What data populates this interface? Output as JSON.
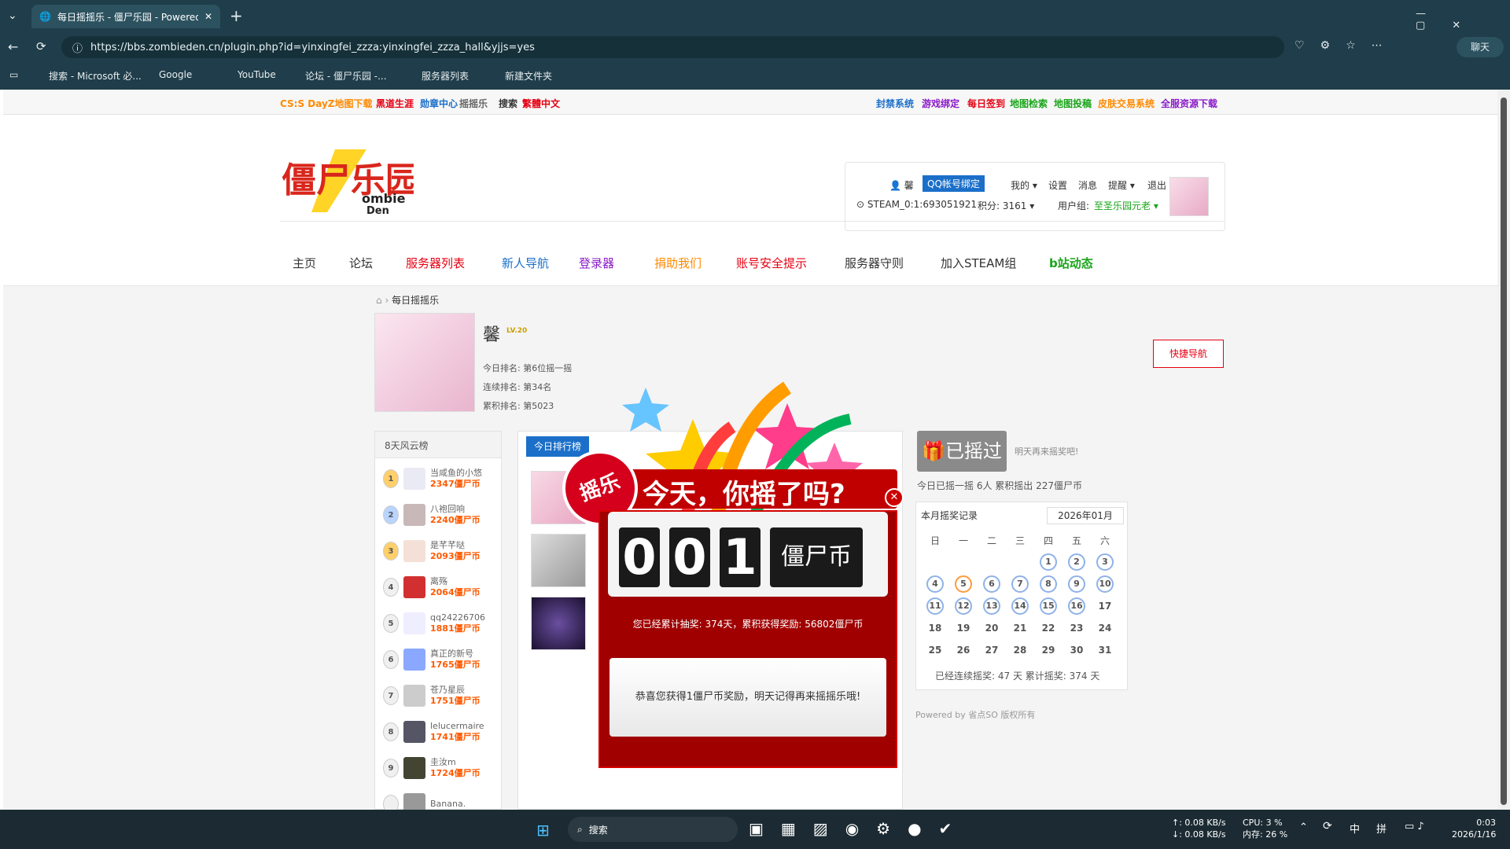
{
  "browser": {
    "tab_title": "每日摇摇乐 - 僵尸乐园 - Powered",
    "url": "https://bbs.zombieden.cn/plugin.php?id=yinxingfei_zzza:yinxingfei_zzza_hall&yjjs=yes",
    "chat_label": "聊天",
    "bookmarks": [
      "搜索 - Microsoft 必...",
      "Google",
      "YouTube",
      "论坛 - 僵尸乐园 -...",
      "服务器列表",
      "新建文件夹"
    ]
  },
  "toplinks_left": [
    "CS:S DayZ地图下载",
    "黑道生涯",
    "勋章中心",
    "摇摇乐",
    "搜索",
    "繁體中文"
  ],
  "toplinks_right": [
    "封禁系统",
    "游戏绑定",
    "每日签到",
    "地图检索",
    "地图投稿",
    "皮肤交易系统",
    "全服资源下载"
  ],
  "logo": {
    "cn": "僵尸乐园",
    "en1": "ombie",
    "en2": "Den"
  },
  "user": {
    "name": "馨",
    "qq_bind": "QQ帐号绑定",
    "links": [
      "我的",
      "设置",
      "消息",
      "提醒",
      "退出"
    ],
    "steam": "STEAM_0:1:693051921",
    "points": "积分: 3161",
    "group_label": "用户组:",
    "group": "至圣乐园元老"
  },
  "nav": [
    "主页",
    "论坛",
    "服务器列表",
    "新人导航",
    "登录器",
    "捐助我们",
    "账号安全提示",
    "服务器守则",
    "加入STEAM组",
    "b站动态"
  ],
  "quick_nav": "快捷导航",
  "breadcrumb": "每日摇摇乐",
  "profile": {
    "name": "馨",
    "level": "LV.20",
    "today_rank": "今日排名: 第6位摇一摇",
    "cont_rank": "连续排名: 第34名",
    "total_rank": "累积排名: 第5023"
  },
  "ranking": {
    "title": "8天风云榜",
    "rows": [
      {
        "no": "1",
        "name": "当咸鱼的小悠",
        "val": "2347僵尸币"
      },
      {
        "no": "2",
        "name": "八袍回响",
        "val": "2240僵尸币"
      },
      {
        "no": "3",
        "name": "是芊芊哒",
        "val": "2093僵尸币"
      },
      {
        "no": "4",
        "name": "离殇",
        "val": "2064僵尸币"
      },
      {
        "no": "5",
        "name": "qq24226706",
        "val": "1881僵尸币"
      },
      {
        "no": "6",
        "name": "真正的新号",
        "val": "1765僵尸币"
      },
      {
        "no": "7",
        "name": "苍乃星辰",
        "val": "1751僵尸币"
      },
      {
        "no": "8",
        "name": "lelucermaire",
        "val": "1741僵尸币"
      },
      {
        "no": "9",
        "name": "圭汝m",
        "val": "1724僵尸币"
      },
      {
        "no": "",
        "name": "Banana.",
        "val": ""
      }
    ]
  },
  "today_tab": "今日排行榜",
  "shake": {
    "done_btn": "已摇过",
    "hint": "明天再来摇奖吧!",
    "stats": "今日已摇一摇 6人 累积摇出 227僵尸币"
  },
  "calendar": {
    "title": "本月摇奖记录",
    "month": "2026年01月",
    "weekdays": [
      "日",
      "一",
      "二",
      "三",
      "四",
      "五",
      "六"
    ],
    "weeks": [
      [
        "",
        "",
        "",
        "",
        "1",
        "2",
        "3"
      ],
      [
        "4",
        "5",
        "6",
        "7",
        "8",
        "9",
        "10"
      ],
      [
        "11",
        "12",
        "13",
        "14",
        "15",
        "16",
        "17"
      ],
      [
        "18",
        "19",
        "20",
        "21",
        "22",
        "23",
        "24"
      ],
      [
        "25",
        "26",
        "27",
        "28",
        "29",
        "30",
        "31"
      ]
    ],
    "summary": "已经连续摇奖: 47 天  累计摇奖: 374 天"
  },
  "powered": "Powered by 省点SO 版权所有",
  "popup": {
    "badge": "摇乐",
    "headline": "今天，你摇了吗?",
    "digits": [
      "0",
      "0",
      "1"
    ],
    "unit": "僵尸币",
    "total": "您已经累计抽奖: 374天，累积获得奖励: 56802僵尸币",
    "message": "恭喜您获得1僵尸币奖励，明天记得再来摇摇乐哦!"
  },
  "taskbar": {
    "search": "搜索",
    "net_up": "↑: 0.08 KB/s",
    "net_down": "↓: 0.08 KB/s",
    "cpu": "CPU: 3 %",
    "mem": "内存: 26 %",
    "ime1": "中",
    "ime2": "拼",
    "time": "0:03",
    "date": "2026/1/16"
  },
  "colors": {
    "accent_red": "#e60012",
    "popup_red": "#a00000",
    "orange": "#ff5a00"
  }
}
